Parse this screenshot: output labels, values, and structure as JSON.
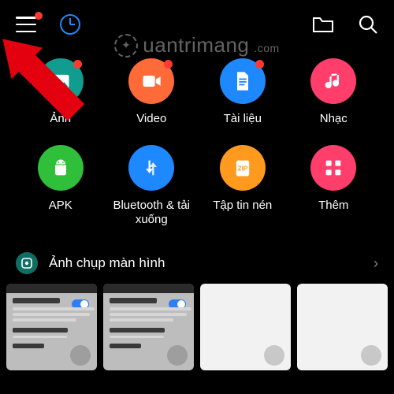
{
  "topbar": {
    "menu_has_notification": true
  },
  "watermark": {
    "text": "uantrimang",
    "suffix": ".com"
  },
  "categories": [
    {
      "key": "images",
      "label": "Ảnh",
      "color": "#109c8f",
      "icon": "image",
      "notify": true
    },
    {
      "key": "video",
      "label": "Video",
      "color": "#ff6a39",
      "icon": "video",
      "notify": true
    },
    {
      "key": "docs",
      "label": "Tài liệu",
      "color": "#1e88ff",
      "icon": "document",
      "notify": true
    },
    {
      "key": "music",
      "label": "Nhạc",
      "color": "#ff3e6c",
      "icon": "music",
      "notify": false
    },
    {
      "key": "apk",
      "label": "APK",
      "color": "#2fbf3a",
      "icon": "android",
      "notify": false
    },
    {
      "key": "bt",
      "label": "Bluetooth & tải xuống",
      "color": "#1e88ff",
      "icon": "transfer",
      "notify": false
    },
    {
      "key": "zip",
      "label": "Tập tin nén",
      "color": "#ff9a1f",
      "icon": "zip",
      "notify": false
    },
    {
      "key": "more",
      "label": "Thêm",
      "color": "#ff3e6c",
      "icon": "grid",
      "notify": false
    }
  ],
  "section": {
    "title": "Ảnh chụp màn hình",
    "icon": "screenshot"
  },
  "thumbs": {
    "count": 4,
    "variant": [
      "settings",
      "settings",
      "blank",
      "blank"
    ],
    "settings_card": {
      "heading": "Rút lại chấp thuận",
      "row1": "Chính sách Riêng tư",
      "row2": "Giới thiệu"
    }
  }
}
